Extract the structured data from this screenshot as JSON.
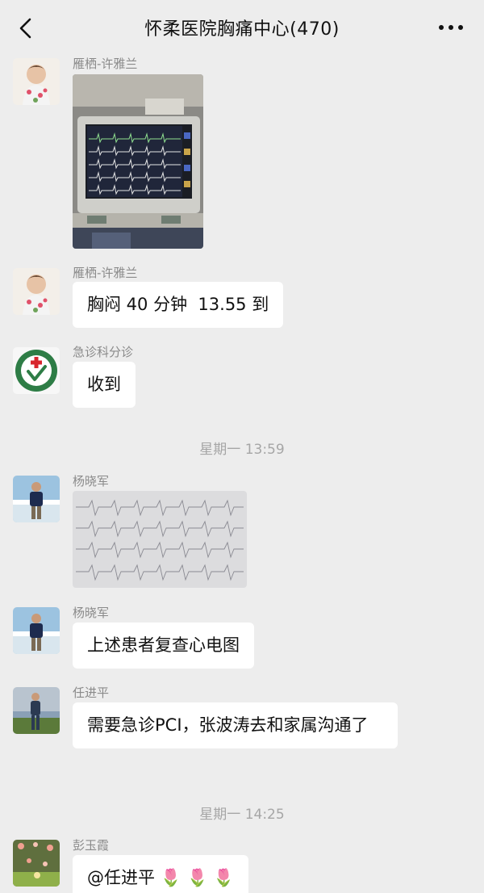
{
  "header": {
    "title": "怀柔医院胸痛中心(470)"
  },
  "messages": [
    {
      "sender": "雁栖-许雅兰",
      "type": "image",
      "image_desc": "ecg-monitor-photo"
    },
    {
      "sender": "雁栖-许雅兰",
      "type": "text",
      "text": "胸闷 40 分钟  13.55 到"
    },
    {
      "sender": "急诊科分诊",
      "type": "text",
      "text": "收到"
    },
    {
      "sender": "杨晓军",
      "type": "image",
      "image_desc": "ecg-paper-photo"
    },
    {
      "sender": "杨晓军",
      "type": "text",
      "text": "上述患者复查心电图"
    },
    {
      "sender": "任进平",
      "type": "text",
      "text": "需要急诊PCI，张波涛去和家属沟通了"
    },
    {
      "sender": "彭玉霞",
      "type": "text",
      "text": "@任进平 🌷 🌷 🌷"
    }
  ],
  "timestamps": [
    "星期一 13:59",
    "星期一 14:25"
  ],
  "icons": {
    "back": "chevron-left-icon",
    "more": "more-dots-icon"
  },
  "colors": {
    "background": "#ededed",
    "bubble": "#ffffff",
    "meta_text": "#8a8a8a"
  }
}
